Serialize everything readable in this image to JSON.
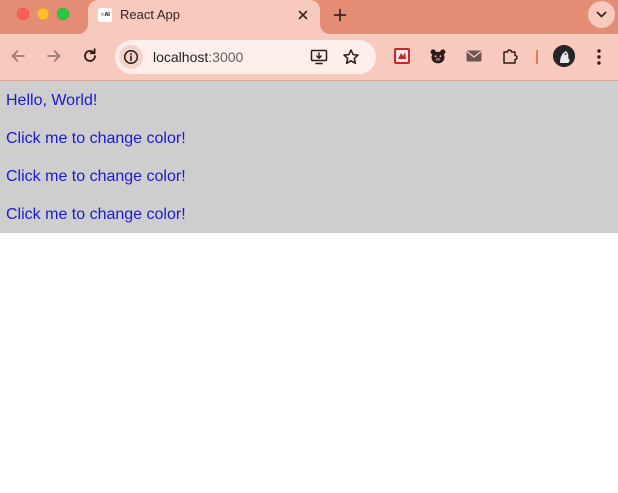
{
  "browser": {
    "tab": {
      "favicon_text": "⚛AI",
      "title": "React App"
    },
    "address_bar": {
      "host": "localhost",
      "port": ":3000"
    },
    "colors": {
      "tab_strip": "#e58c75",
      "toolbar": "#f8c9bd",
      "omnibox": "#fdf0ec"
    },
    "icons": {
      "back": "arrow-left-icon",
      "forward": "arrow-right-icon",
      "reload": "reload-icon",
      "site_info": "info-icon",
      "install": "install-app-icon",
      "bookmark": "star-icon",
      "extensions": [
        "red-extension-icon",
        "bear-extension-icon",
        "mail-extension-icon",
        "puzzle-icon"
      ],
      "menu": "kebab-menu-icon"
    }
  },
  "page": {
    "background": "#cecece",
    "text_color": "#1a1ad0",
    "greeting": "Hello, World!",
    "buttons": [
      {
        "label": "Click me to change color!"
      },
      {
        "label": "Click me to change color!"
      },
      {
        "label": "Click me to change color!"
      }
    ]
  }
}
